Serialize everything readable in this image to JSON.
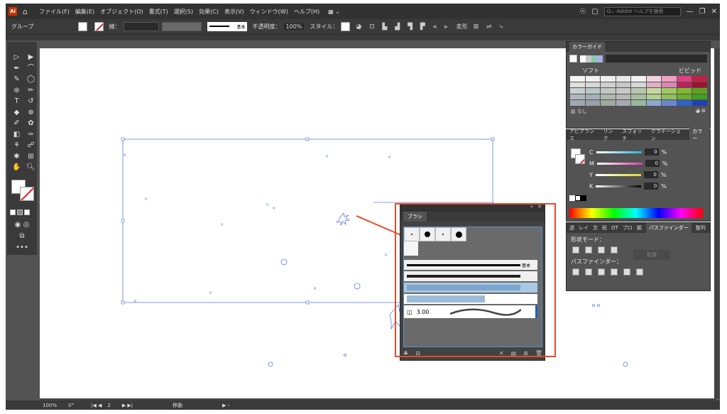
{
  "menubar": {
    "logo": "Ai",
    "items": [
      "ファイル(F)",
      "編集(E)",
      "オブジェクト(O)",
      "書式(T)",
      "選択(S)",
      "効果(C)",
      "表示(V)",
      "ウィンドウ(W)",
      "ヘルプ(H)"
    ],
    "search_placeholder": "Adobe ヘルプを検索"
  },
  "control": {
    "selection_label": "グループ",
    "stroke_label": "線：",
    "stroke_profile": "基本",
    "opacity_label": "不透明度：",
    "opacity_value": "100%",
    "style_label": "スタイル：",
    "transform_label": "変形"
  },
  "color_guide": {
    "tab": "カラーガイド",
    "soft_label": "ソフト",
    "vivid_label": "ビビッド",
    "none_label": "なし",
    "strip": [
      "#ffffff",
      "#c8c8c8",
      "#88ccaa",
      "#aab0ee"
    ],
    "grid": [
      "#f4f4f4",
      "#f0f0f0",
      "#eeeeee",
      "#e8e8e8",
      "#f0f0f0",
      "#f4d0e0",
      "#f0a0c0",
      "#e04080",
      "#c02040",
      "#e0e0e0",
      "#d8d8d8",
      "#d0d0d0",
      "#c8c8c8",
      "#d8d8d8",
      "#e0b0c8",
      "#d888b0",
      "#c02060",
      "#a01030",
      "#c8d0d0",
      "#b8c8c8",
      "#c0c8c0",
      "#c8c8c8",
      "#b8c8b0",
      "#c8d8a0",
      "#a0c860",
      "#80b830",
      "#60a020",
      "#b0b8c0",
      "#a8b0b8",
      "#b0b8b0",
      "#b8b8b8",
      "#a8c0a0",
      "#b0d090",
      "#90c060",
      "#68b030",
      "#40a020",
      "#a0a8b0",
      "#98a0a8",
      "#a0a8a0",
      "#a8a8b0",
      "#98b8a0",
      "#90a8d0",
      "#6888d0",
      "#3060c8",
      "#2040b0"
    ]
  },
  "color_panel": {
    "tabs": [
      "アピアランス",
      "リンク",
      "スウォッチ",
      "グラデーション",
      "カラー"
    ],
    "active_tab": "カラー",
    "channels": [
      {
        "label": "C",
        "value": "0",
        "color": "#28b4dc"
      },
      {
        "label": "M",
        "value": "0",
        "color": "#dc3cb4"
      },
      {
        "label": "Y",
        "value": "0",
        "color": "#dcdc28"
      },
      {
        "label": "K",
        "value": "0",
        "color": "#ffffff"
      }
    ],
    "unit": "%"
  },
  "pathfinder": {
    "tabs": [
      "透",
      "レイ",
      "文",
      "段",
      "OT",
      "プロ",
      "揃",
      "パスファインダー",
      "整列"
    ],
    "active_tab": "パスファインダー",
    "shape_mode_label": "形状モード：",
    "pathfinder_label": "パスファインダー：",
    "expand_label": "拡張"
  },
  "brush_panel": {
    "tab": "ブラシ",
    "basic_label": "基本",
    "selected_size": "3.00"
  },
  "status": {
    "zoom": "100%",
    "rotation": "0°",
    "page": "2",
    "tool": "移動"
  },
  "annotation_color": "#e84a2a"
}
